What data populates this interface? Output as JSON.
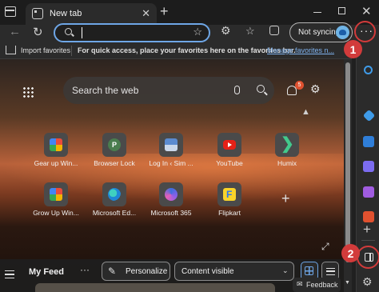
{
  "titlebar": {
    "tab_title": "New tab",
    "tab_close": "✕",
    "new_tab": "+",
    "close_window": "✕"
  },
  "toolbar": {
    "back": "←",
    "refresh": "↻",
    "address_value": "",
    "address_favorite": "☆",
    "extensions": "⚙",
    "favorites": "☆",
    "sync_label": "Not syncing",
    "more_dots": "···"
  },
  "favorites_bar": {
    "import_label": "Import favorites",
    "hint": "For quick access, place your favorites here on the favorites bar.",
    "manage_link": "Manage favorites n..."
  },
  "callouts": [
    "1",
    "2"
  ],
  "sidebar": {
    "add": "+",
    "settings": "⚙"
  },
  "ntp": {
    "search_placeholder": "Search the web",
    "notification_count": "5",
    "settings": "⚙",
    "collapse": "▲",
    "add_shortcut": "+",
    "expand": "⤢",
    "tiles": [
      {
        "label": "Gear up Win...",
        "icon": "gear-up-windows-icon"
      },
      {
        "label": "Browser Lock",
        "icon": "browser-lock-icon"
      },
      {
        "label": "Log In ‹ Sim ...",
        "icon": "login-icon"
      },
      {
        "label": "YouTube",
        "icon": "youtube-icon"
      },
      {
        "label": "Humix",
        "icon": "humix-icon"
      },
      {
        "label": "Grow Up Win...",
        "icon": "grow-up-windows-icon"
      },
      {
        "label": "Microsoft Ed...",
        "icon": "microsoft-edge-icon"
      },
      {
        "label": "Microsoft 365",
        "icon": "microsoft-365-icon"
      },
      {
        "label": "Flipkart",
        "icon": "flipkart-icon"
      }
    ]
  },
  "feed": {
    "title": "My Feed",
    "more": "···",
    "personalize_label": "Personalize",
    "content_select_value": "Content visible",
    "content_select_chevron": "⌄",
    "feedback_label": "Feedback"
  }
}
